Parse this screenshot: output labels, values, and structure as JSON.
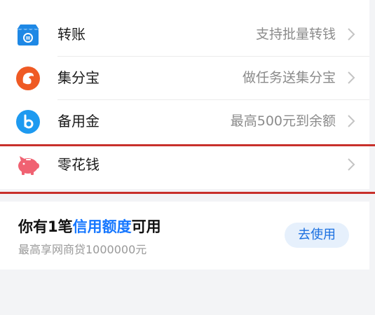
{
  "rows": [
    {
      "label": "转账",
      "desc": "支持批量转钱",
      "icon": "transfer-shop-icon"
    },
    {
      "label": "集分宝",
      "desc": "做任务送集分宝",
      "icon": "jifenbao-icon"
    },
    {
      "label": "备用金",
      "desc": "最高500元到余额",
      "icon": "beiyongjin-icon"
    },
    {
      "label": "零花钱",
      "desc": "",
      "icon": "piggy-bank-icon"
    }
  ],
  "promo": {
    "title_prefix": "你有1笔",
    "title_highlight": "信用额度",
    "title_suffix": "可用",
    "subtitle": "最高享网商贷1000000元",
    "button_label": "去使用"
  },
  "colors": {
    "accent": "#1677ff",
    "transfer_icon": "#1e88e5",
    "jifenbao_icon": "#ef5a24",
    "beiyongjin_icon": "#1e9af0",
    "piggy_icon": "#f06272",
    "highlight_border": "#c8302b"
  }
}
